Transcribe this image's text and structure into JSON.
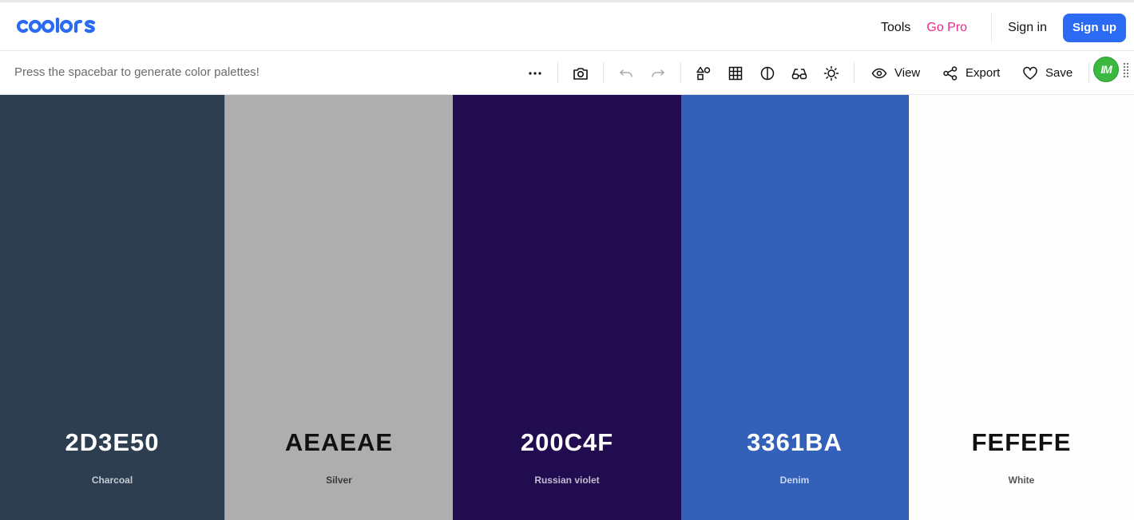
{
  "header": {
    "logo_text": "coolors",
    "nav": {
      "tools": "Tools",
      "go_pro": "Go Pro",
      "sign_in": "Sign in",
      "sign_up": "Sign up"
    }
  },
  "toolbar": {
    "hint": "Press the spacebar to generate color palettes!",
    "icons": [
      "more-icon",
      "camera-icon",
      "undo-icon",
      "redo-icon",
      "shapes-icon",
      "grid-icon",
      "contrast-icon",
      "glasses-icon",
      "sun-icon"
    ],
    "actions": {
      "view": "View",
      "export": "Export",
      "save": "Save"
    },
    "avatar_initials": "IM"
  },
  "palette": [
    {
      "hex": "2D3E50",
      "name": "Charcoal",
      "color": "#2D3E50",
      "text_color": "#ffffff",
      "name_color": "#c6ccd3"
    },
    {
      "hex": "AEAEAE",
      "name": "Silver",
      "color": "#AEAEAE",
      "text_color": "#111111",
      "name_color": "#3a3a3a"
    },
    {
      "hex": "200C4F",
      "name": "Russian violet",
      "color": "#200C4F",
      "text_color": "#ffffff",
      "name_color": "#c2bdd2"
    },
    {
      "hex": "3361BA",
      "name": "Denim",
      "color": "#3361BA",
      "text_color": "#ffffff",
      "name_color": "#c9d6ef"
    },
    {
      "hex": "FEFEFE",
      "name": "White",
      "color": "#FEFEFE",
      "text_color": "#111111",
      "name_color": "#555555"
    }
  ],
  "colors": {
    "brand_blue": "#2b6af2",
    "go_pro_pink": "#e62b86",
    "avatar_green": "#3ab83f"
  }
}
